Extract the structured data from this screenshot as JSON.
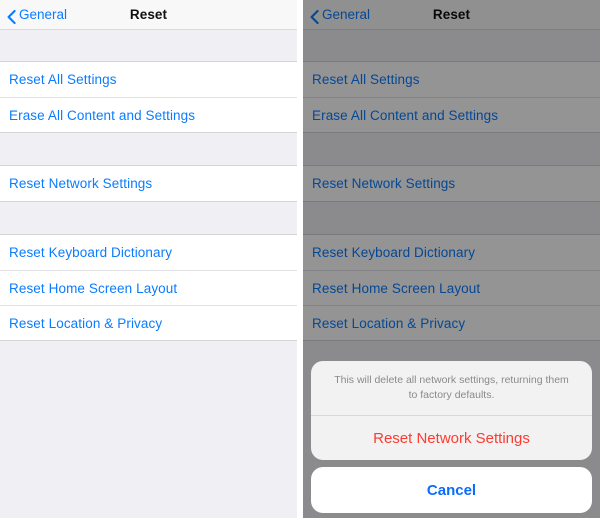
{
  "nav": {
    "back_label": "General",
    "back_icon": "chevron-left-icon",
    "title": "Reset"
  },
  "list": {
    "groups": [
      {
        "rows": [
          {
            "label": "Reset All Settings"
          },
          {
            "label": "Erase All Content and Settings"
          }
        ]
      },
      {
        "rows": [
          {
            "label": "Reset Network Settings"
          }
        ]
      },
      {
        "rows": [
          {
            "label": "Reset Keyboard Dictionary"
          },
          {
            "label": "Reset Home Screen Layout"
          },
          {
            "label": "Reset Location & Privacy"
          }
        ]
      }
    ]
  },
  "action_sheet": {
    "message": "This will delete all network settings, returning them to factory defaults.",
    "destructive_label": "Reset Network Settings",
    "cancel_label": "Cancel"
  },
  "colors": {
    "tint_blue": "#0A7CFF",
    "destructive_red": "#FF3B30",
    "background_gray": "#EFEFF4",
    "row_white": "#FFFFFF"
  }
}
